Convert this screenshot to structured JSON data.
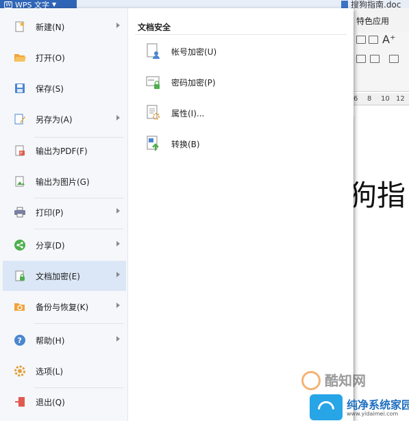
{
  "app": {
    "button_label": "WPS 文字",
    "document_tab": "搜狗指南.doc",
    "ribbon_tab": "特色应用",
    "ruler_ticks": [
      "6",
      "8",
      "10",
      "12"
    ],
    "document_text": "狗指"
  },
  "menu": {
    "items": [
      {
        "label": "新建(N)",
        "icon": "new-doc-icon",
        "has_submenu": true
      },
      {
        "label": "打开(O)",
        "icon": "open-folder-icon",
        "has_submenu": false
      },
      {
        "label": "保存(S)",
        "icon": "save-icon",
        "has_submenu": false
      },
      {
        "label": "另存为(A)",
        "icon": "save-as-icon",
        "has_submenu": true
      },
      {
        "label": "输出为PDF(F)",
        "icon": "pdf-icon",
        "has_submenu": false
      },
      {
        "label": "输出为图片(G)",
        "icon": "image-export-icon",
        "has_submenu": false
      },
      {
        "label": "打印(P)",
        "icon": "printer-icon",
        "has_submenu": true
      },
      {
        "label": "分享(D)",
        "icon": "share-icon",
        "has_submenu": true
      },
      {
        "label": "文档加密(E)",
        "icon": "doc-encrypt-icon",
        "has_submenu": true,
        "selected": true
      },
      {
        "label": "备份与恢复(K)",
        "icon": "backup-icon",
        "has_submenu": true
      },
      {
        "label": "帮助(H)",
        "icon": "help-icon",
        "has_submenu": true
      },
      {
        "label": "选项(L)",
        "icon": "gear-icon",
        "has_submenu": false
      },
      {
        "label": "退出(Q)",
        "icon": "exit-icon",
        "has_submenu": false
      }
    ]
  },
  "submenu": {
    "title": "文档安全",
    "items": [
      {
        "label": "帐号加密(U)",
        "icon": "account-encrypt-icon"
      },
      {
        "label": "密码加密(P)",
        "icon": "password-encrypt-icon"
      },
      {
        "label": "属性(I)...",
        "icon": "properties-icon"
      },
      {
        "label": "转换(B)",
        "icon": "convert-icon"
      }
    ]
  },
  "watermarks": {
    "site1": "酷知网",
    "site2": "纯净系统家园",
    "site2_url": "www.yidaimei.com"
  },
  "colors": {
    "accent": "#2f65b7",
    "selected_bg": "#dbe7f6",
    "menu_bg": "#f5f7fa"
  }
}
